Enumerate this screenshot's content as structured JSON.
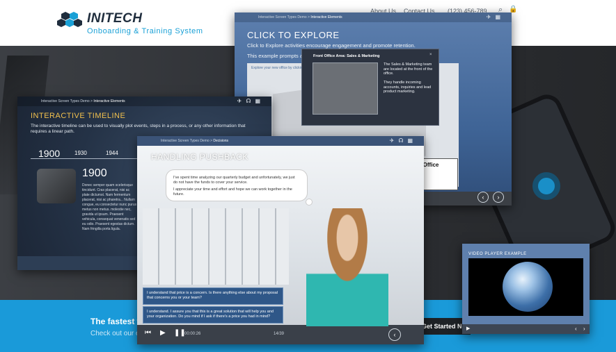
{
  "brand": {
    "name": "INITECH",
    "subtitle": "Onboarding & Training System"
  },
  "top_nav": {
    "about": "About Us",
    "contact": "Contact Us",
    "phone": "(123) 456-789"
  },
  "hero": {
    "title": "The fastest w",
    "subtitle": "Check out our op",
    "cta": "Get Started Now"
  },
  "explore_window": {
    "breadcrumb_root": "Interactive Screen Types Demo",
    "breadcrumb_current": "Interactive Elements",
    "title": "CLICK TO EXPLORE",
    "description": "Click to Explore activities encourage engagement and promote retention.",
    "example": "This example prompts a",
    "inner_label": "Explore your new office by clicking",
    "sign_text": "e Office",
    "popup": {
      "title": "Front Office Area: Sales & Marketing",
      "close": "×",
      "text1": "The Sales & Marketing team are located at the front of the office.",
      "text2": "They handle incoming accounts, inquiries and lead product marketing."
    }
  },
  "timeline_window": {
    "breadcrumb_root": "Interactive Screen Types Demo",
    "breadcrumb_current": "Interactive Elements",
    "title": "INTERACTIVE TIMELINE",
    "description": "The interactive timeline can be used to visually plot events, steps in a process, or any other information that requires a linear path.",
    "years": [
      "1900",
      "1930",
      "1944"
    ],
    "selected_year": "1900",
    "body": "Donec semper quam scelerisque tincidunt. Cras placerat, nisi ac plate dictumst. Nam fermentum placerat, nisi ac pharetra... Nullam congue, eu consectetur nunc purus metus non metus. molestie nec, gravida ut ipsum. Praesent vehicula, consequat venenatis sed eu odio. Praesent egestas dictum. Nam fringilla porta ligula."
  },
  "pushback_window": {
    "breadcrumb_root": "Interactive Screen Types Demo",
    "breadcrumb_current": "Decisions",
    "title": "HANDLING PUSHBACK",
    "bubble_line1": "I've spent time analyzing our quarterly budget and unfortunately, we just do not have the funds to cover your service.",
    "bubble_line2": "I appreciate your time and effort and hope we can work together in the future.",
    "choice1": "I understand that price is a concern. Is there anything else about my proposal that concerns you or your team?",
    "choice2": "I understand. I assure you that this is a great solution that will help you and your organization. Do you mind if I ask if there's a price you had in mind?",
    "time": "00:00:26",
    "page": "14/39"
  },
  "video_window": {
    "title": "VIDEO PLAYER EXAMPLE"
  },
  "icons": {
    "back": "chevron-left-icon",
    "next": "chevron-right-icon",
    "menu": "grid-menu-icon",
    "search": "search-icon",
    "lock": "lock-icon",
    "rewind": "rewind-icon",
    "play": "play-icon",
    "pause": "pause-icon"
  },
  "colors": {
    "accent": "#1a9ad9",
    "timeline_title": "#f2c14e",
    "choice_bg": "#2f5788",
    "window_bar": "#3b5377"
  }
}
